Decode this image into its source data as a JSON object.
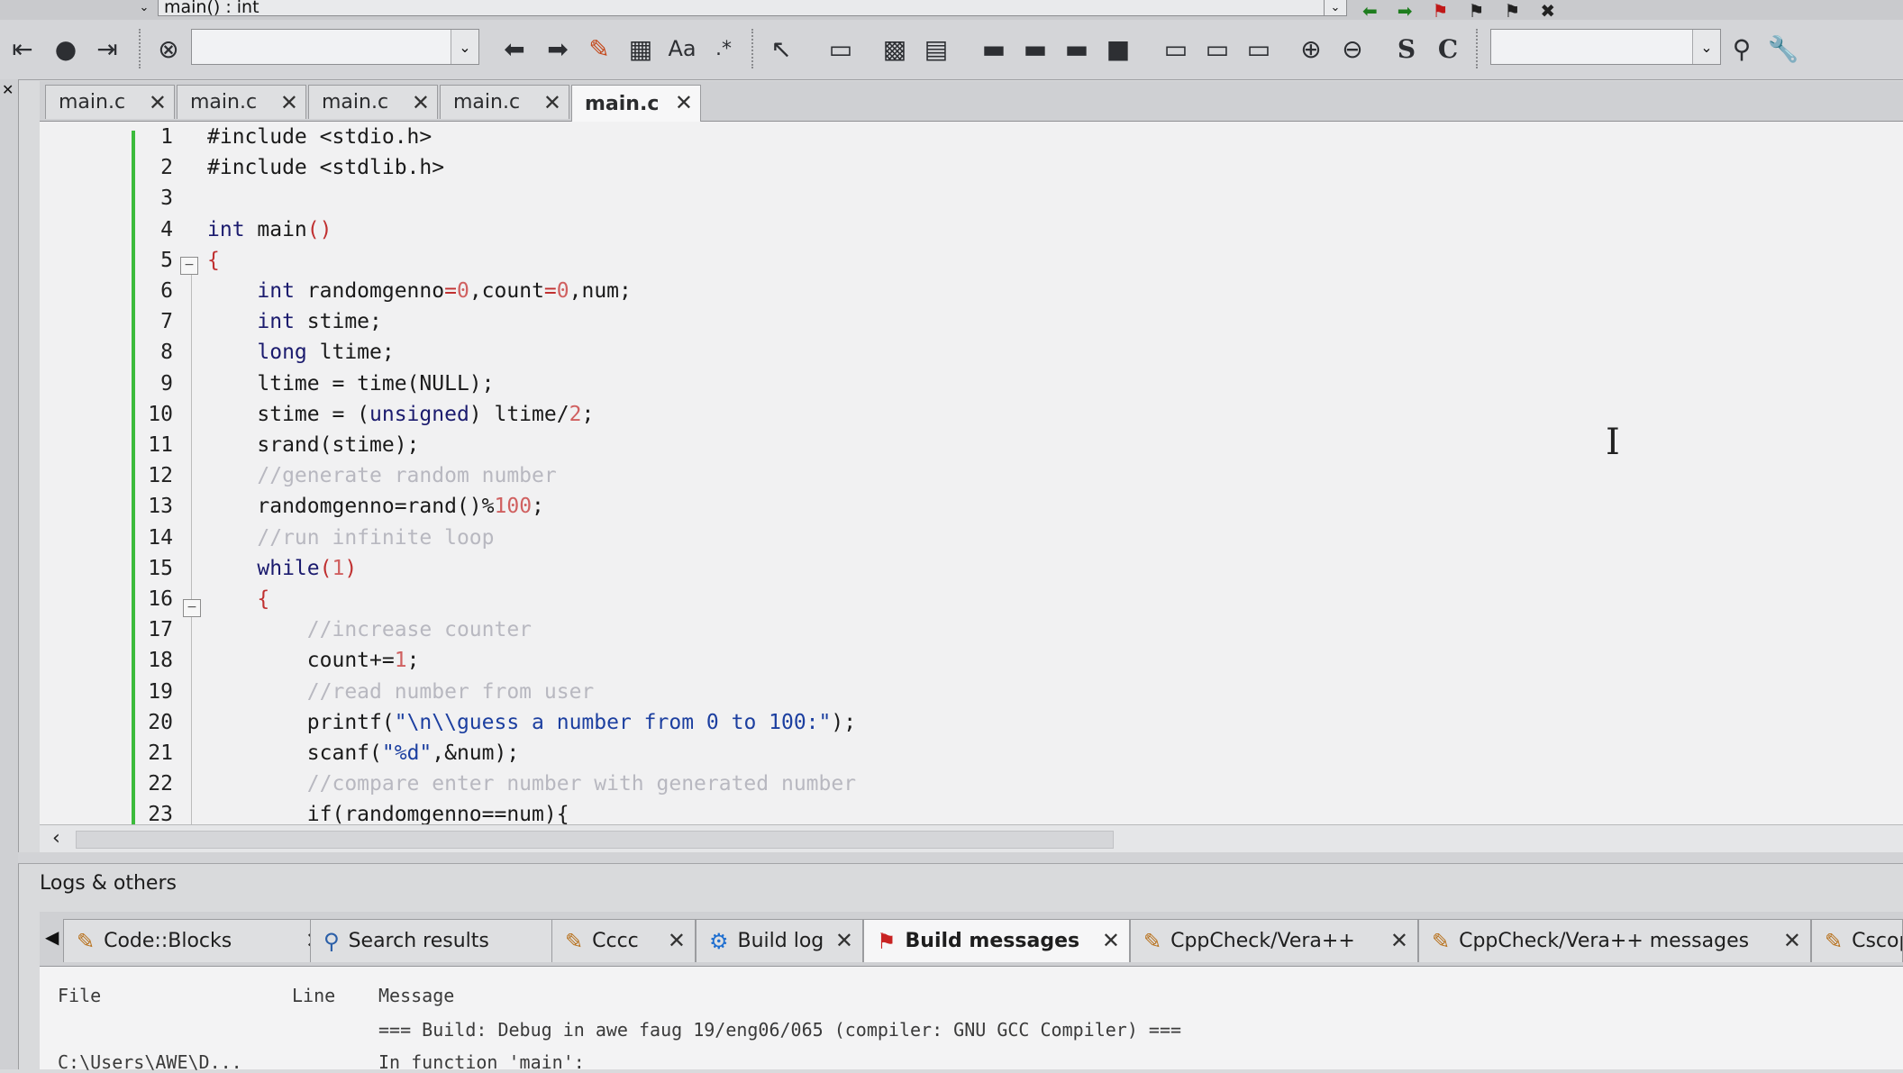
{
  "scope": {
    "function": "main() : int"
  },
  "tabs": [
    "main.c",
    "main.c",
    "main.c",
    "main.c",
    "main.c"
  ],
  "active_tab_index": 4,
  "code_lines": [
    {
      "n": "1",
      "segments": [
        {
          "t": "#include <stdio.h>",
          "c": "plain"
        }
      ]
    },
    {
      "n": "2",
      "segments": [
        {
          "t": "#include <stdlib.h>",
          "c": "plain"
        }
      ]
    },
    {
      "n": "3",
      "segments": []
    },
    {
      "n": "4",
      "segments": [
        {
          "t": "int",
          "c": "kw"
        },
        {
          "t": " main",
          "c": "plain"
        },
        {
          "t": "()",
          "c": "op"
        }
      ]
    },
    {
      "n": "5",
      "segments": [
        {
          "t": "{",
          "c": "op"
        }
      ]
    },
    {
      "n": "6",
      "segments": [
        {
          "t": "    int",
          "c": "kw"
        },
        {
          "t": " randomgenno",
          "c": "plain"
        },
        {
          "t": "=",
          "c": "op"
        },
        {
          "t": "0",
          "c": "num"
        },
        {
          "t": ",count",
          "c": "plain"
        },
        {
          "t": "=",
          "c": "op"
        },
        {
          "t": "0",
          "c": "num"
        },
        {
          "t": ",num;",
          "c": "plain"
        }
      ]
    },
    {
      "n": "7",
      "segments": [
        {
          "t": "    int",
          "c": "kw"
        },
        {
          "t": " stime;",
          "c": "plain"
        }
      ]
    },
    {
      "n": "8",
      "segments": [
        {
          "t": "    long",
          "c": "kw"
        },
        {
          "t": " ltime;",
          "c": "plain"
        }
      ]
    },
    {
      "n": "9",
      "segments": [
        {
          "t": "    ltime = time(NULL);",
          "c": "plain"
        }
      ]
    },
    {
      "n": "10",
      "segments": [
        {
          "t": "    stime = (",
          "c": "plain"
        },
        {
          "t": "unsigned",
          "c": "kw"
        },
        {
          "t": ") ltime/",
          "c": "plain"
        },
        {
          "t": "2",
          "c": "num"
        },
        {
          "t": ";",
          "c": "plain"
        }
      ]
    },
    {
      "n": "11",
      "segments": [
        {
          "t": "    srand(stime);",
          "c": "plain"
        }
      ]
    },
    {
      "n": "12",
      "segments": [
        {
          "t": "    //generate random number",
          "c": "cmt"
        }
      ]
    },
    {
      "n": "13",
      "segments": [
        {
          "t": "    randomgenno=rand()%",
          "c": "plain"
        },
        {
          "t": "100",
          "c": "num"
        },
        {
          "t": ";",
          "c": "plain"
        }
      ]
    },
    {
      "n": "14",
      "segments": [
        {
          "t": "    //run infinite loop",
          "c": "cmt"
        }
      ]
    },
    {
      "n": "15",
      "segments": [
        {
          "t": "    while",
          "c": "kw"
        },
        {
          "t": "(",
          "c": "op"
        },
        {
          "t": "1",
          "c": "num"
        },
        {
          "t": ")",
          "c": "op"
        }
      ]
    },
    {
      "n": "16",
      "segments": [
        {
          "t": "    {",
          "c": "op"
        }
      ]
    },
    {
      "n": "17",
      "segments": [
        {
          "t": "        //increase counter",
          "c": "cmt"
        }
      ]
    },
    {
      "n": "18",
      "segments": [
        {
          "t": "        count+=",
          "c": "plain"
        },
        {
          "t": "1",
          "c": "num"
        },
        {
          "t": ";",
          "c": "plain"
        }
      ]
    },
    {
      "n": "19",
      "segments": [
        {
          "t": "        //read number from user",
          "c": "cmt"
        }
      ]
    },
    {
      "n": "20",
      "segments": [
        {
          "t": "        printf(",
          "c": "plain"
        },
        {
          "t": "\"\\n\\\\guess a number from 0 to 100:\"",
          "c": "str"
        },
        {
          "t": ");",
          "c": "plain"
        }
      ]
    },
    {
      "n": "21",
      "segments": [
        {
          "t": "        scanf(",
          "c": "plain"
        },
        {
          "t": "\"%d\"",
          "c": "str"
        },
        {
          "t": ",&num);",
          "c": "plain"
        }
      ]
    },
    {
      "n": "22",
      "segments": [
        {
          "t": "        //compare enter number with generated number",
          "c": "cmt"
        }
      ]
    },
    {
      "n": "23",
      "segments": [
        {
          "t": "        if(randomgenno==num){",
          "c": "plain"
        }
      ]
    }
  ],
  "logs": {
    "title": "Logs & others",
    "tabs": [
      {
        "label": "Code::Blocks",
        "icon": "pencil-icon"
      },
      {
        "label": "Search results",
        "icon": "search-icon"
      },
      {
        "label": "Cccc",
        "icon": "pencil-icon"
      },
      {
        "label": "Build log",
        "icon": "gear-icon"
      },
      {
        "label": "Build messages",
        "icon": "flag-icon"
      },
      {
        "label": "CppCheck/Vera++",
        "icon": "pencil-icon"
      },
      {
        "label": "CppCheck/Vera++ messages",
        "icon": "pencil-icon"
      },
      {
        "label": "Cscope",
        "icon": "pencil-icon"
      }
    ],
    "active_tab_index": 4,
    "columns": [
      "File",
      "Line",
      "Message"
    ],
    "rows": [
      {
        "file": "",
        "line": "",
        "message": "=== Build: Debug in awe faug 19/eng06/065 (compiler: GNU GCC Compiler) ==="
      },
      {
        "file": "C:\\Users\\AWE\\D...",
        "line": "",
        "message": "In function 'main':"
      }
    ]
  }
}
